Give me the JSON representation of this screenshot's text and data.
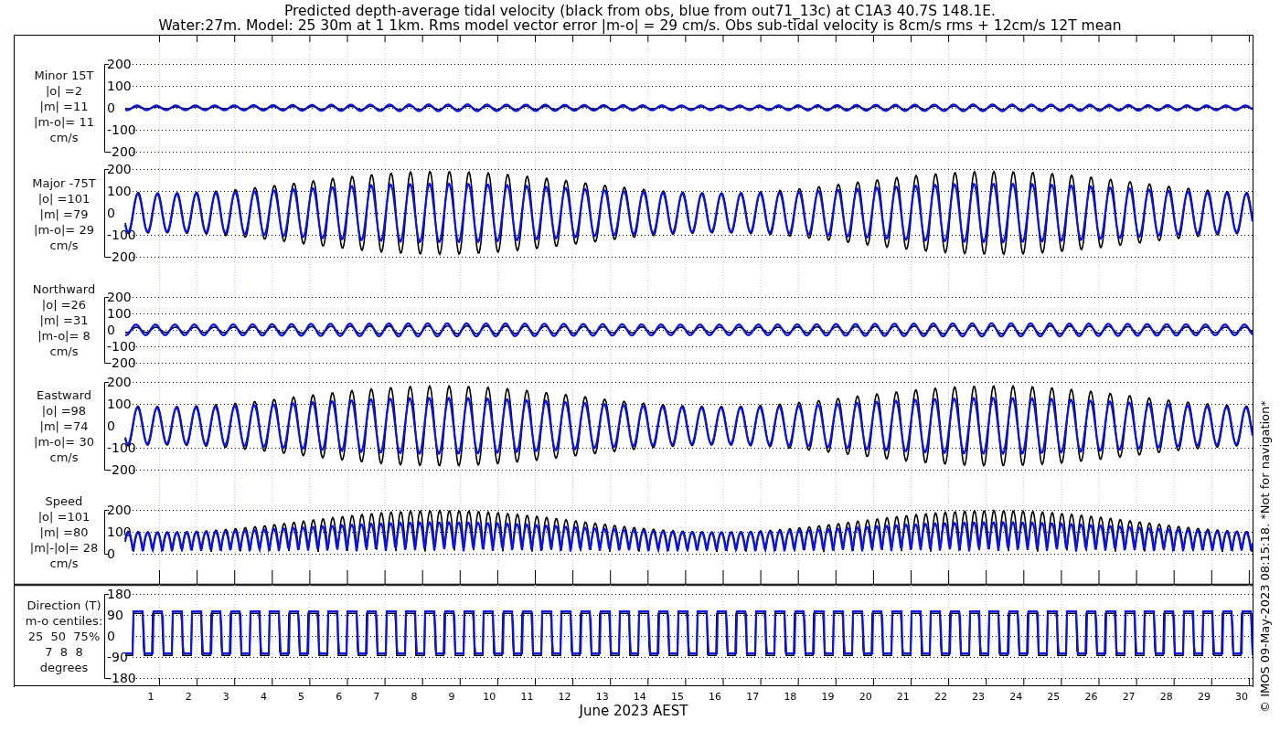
{
  "title": "Predicted depth-average tidal velocity (black from obs, blue from out71_13c) at C1A3 40.7S 148.1E.",
  "subtitle": "Water:27m. Model: 25 30m at 1 1km. Rms model vector error |m-o| = 29 cm/s. Obs sub-tidal velocity is 8cm/s rms + 12cm/s 12T mean",
  "panels": [
    {
      "kind": "minor",
      "label_lines": [
        "Minor 15T",
        "|o| =2",
        "|m| =11",
        "|m-o|= 11",
        "cm/s"
      ],
      "yticks": [
        "200",
        "100",
        "0",
        "-100",
        "-200"
      ]
    },
    {
      "kind": "major",
      "label_lines": [
        "Major -75T",
        "|o| =101",
        "|m| =79",
        "|m-o|= 29",
        "cm/s"
      ],
      "yticks": [
        "200",
        "100",
        "0",
        "-100",
        "-200"
      ]
    },
    {
      "kind": "northward",
      "label_lines": [
        "Northward",
        "|o| =26",
        "|m| =31",
        "|m-o|= 8",
        "cm/s"
      ],
      "yticks": [
        "200",
        "100",
        "0",
        "-100",
        "-200"
      ]
    },
    {
      "kind": "eastward",
      "label_lines": [
        "Eastward",
        "|o| =98",
        "|m| =74",
        "|m-o|= 30",
        "cm/s"
      ],
      "yticks": [
        "200",
        "100",
        "0",
        "-100",
        "-200"
      ]
    },
    {
      "kind": "speed",
      "label_lines": [
        "Speed",
        "|o| =101",
        "|m| =80",
        "|m|-|o|= 28",
        "cm/s"
      ],
      "yticks": [
        "200",
        "100",
        "0"
      ]
    },
    {
      "kind": "direction",
      "label_lines": [
        "Direction (T)",
        "m-o centiles:",
        "25  50  75%",
        "7  8  8",
        "degrees"
      ],
      "yticks": [
        "180",
        "90",
        "0",
        "-90",
        "-180"
      ]
    }
  ],
  "xticks": [
    "1",
    "2",
    "3",
    "4",
    "5",
    "6",
    "7",
    "8",
    "9",
    "10",
    "11",
    "12",
    "13",
    "14",
    "15",
    "16",
    "17",
    "18",
    "19",
    "20",
    "21",
    "22",
    "23",
    "24",
    "25",
    "26",
    "27",
    "28",
    "29",
    "30"
  ],
  "xlabel": "June 2023 AEST",
  "credit": "© IMOS 09-May-2023 08:15:18.  *Not for navigation*"
}
